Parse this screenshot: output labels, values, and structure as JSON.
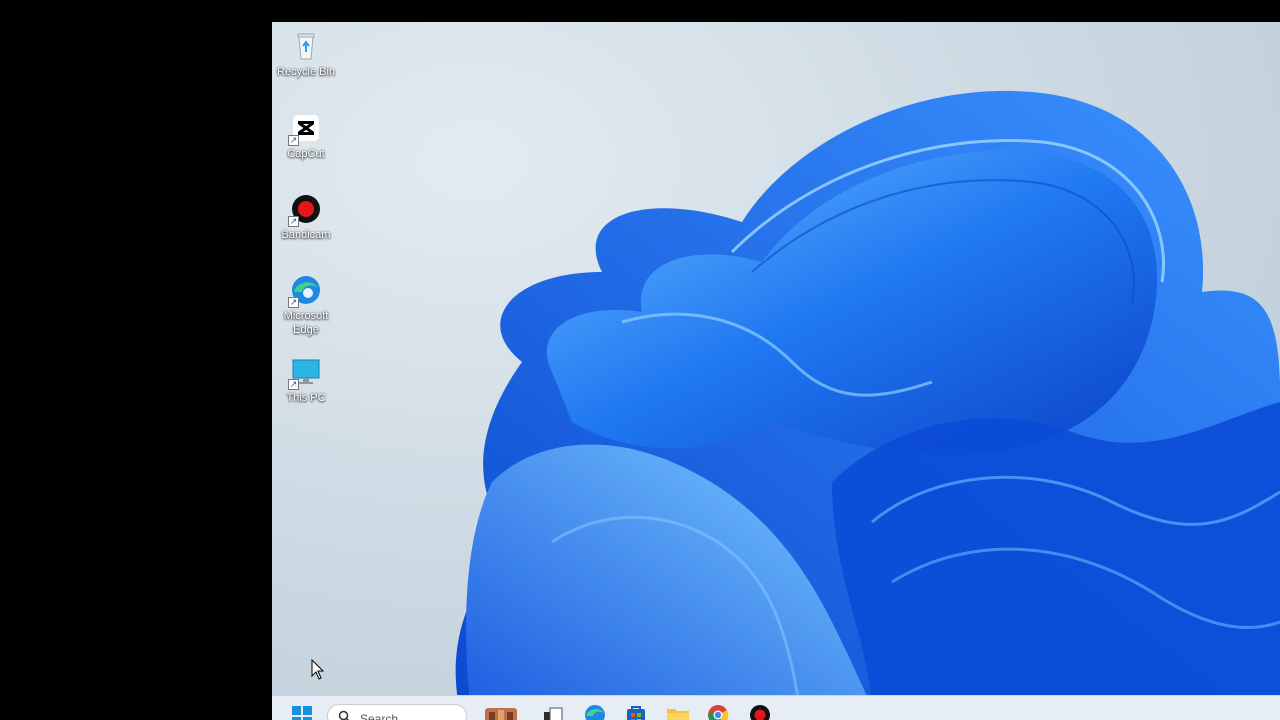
{
  "desktop": {
    "icons": [
      {
        "label": "Recycle Bin",
        "icon": "recycle-bin-icon"
      },
      {
        "label": "CapCut",
        "icon": "capcut-icon"
      },
      {
        "label": "Bandicam",
        "icon": "bandicam-icon"
      },
      {
        "label": "Microsoft\nEdge",
        "icon": "edge-icon"
      },
      {
        "label": "This PC",
        "icon": "this-pc-icon"
      }
    ]
  },
  "taskbar": {
    "search_placeholder": "Search",
    "apps": [
      "start-icon",
      "search-icon",
      "widgets-icon",
      "task-view-icon",
      "edge-icon",
      "store-icon",
      "file-explorer-icon",
      "chrome-icon",
      "bandicam-icon"
    ]
  },
  "colors": {
    "bloom_dark": "#0a3fc6",
    "bloom_mid": "#1f6ff0",
    "bloom_light": "#5fb2ff",
    "taskbar": "#e6edf4"
  }
}
